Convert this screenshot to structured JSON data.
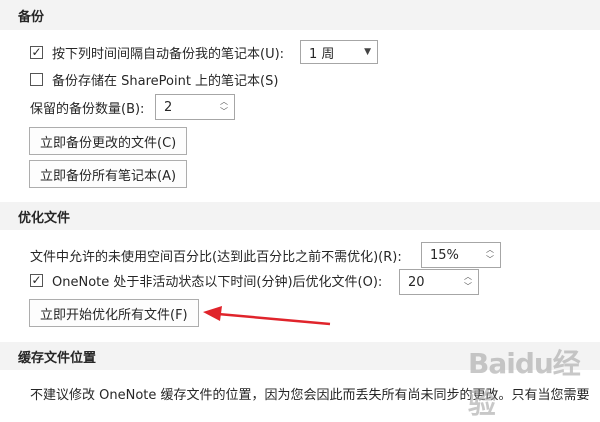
{
  "backup": {
    "header": "备份",
    "auto_backup_label": "按下列时间间隔自动备份我的笔记本(U):",
    "auto_backup_checked": true,
    "interval_value": "1 周",
    "sharepoint_label": "备份存储在 SharePoint 上的笔记本(S)",
    "sharepoint_checked": false,
    "count_label": "保留的备份数量(B):",
    "count_value": "2",
    "backup_changed_button": "立即备份更改的文件(C)",
    "backup_all_button": "立即备份所有笔记本(A)"
  },
  "optimize": {
    "header": "优化文件",
    "unused_label": "文件中允许的未使用空间百分比(达到此百分比之前不需优化)(R):",
    "unused_value": "15%",
    "inactive_label": "OneNote 处于非活动状态以下时间(分钟)后优化文件(O):",
    "inactive_checked": true,
    "inactive_value": "20",
    "optimize_button": "立即开始优化所有文件(F)"
  },
  "cache": {
    "header": "缓存文件位置",
    "description": "不建议修改 OneNote 缓存文件的位置，因为您会因此而丢失所有尚未同步的更改。只有当您需要"
  },
  "watermark": "Baidu经验",
  "colors": {
    "annotation_arrow": "#e0242b",
    "section_bg": "#f3f3f3"
  }
}
